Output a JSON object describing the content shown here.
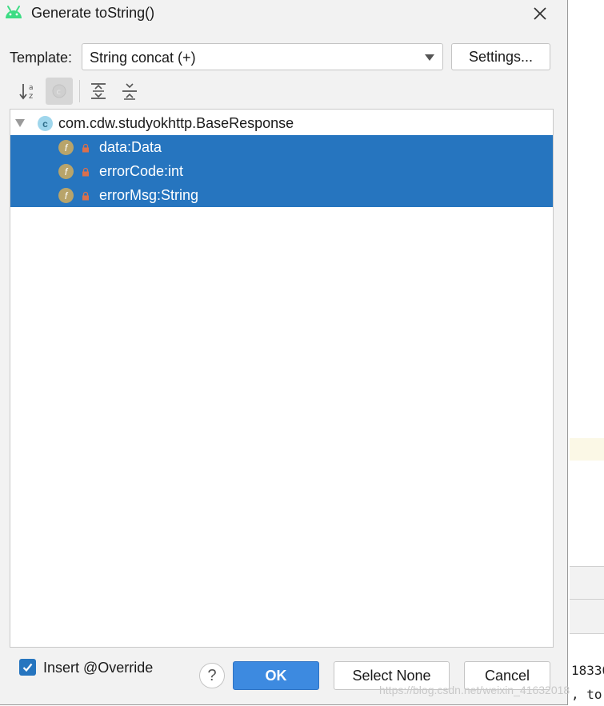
{
  "dialog": {
    "title": "Generate toString()",
    "template_label": "Template:",
    "template_value": "String concat (+)",
    "settings_label": "Settings...",
    "class_name": "com.cdw.studyokhttp.BaseResponse",
    "class_icon_letter": "c",
    "field_icon_letter": "f",
    "fields": [
      {
        "label": "data:Data",
        "selected": true
      },
      {
        "label": "errorCode:int",
        "selected": true
      },
      {
        "label": "errorMsg:String",
        "selected": true
      }
    ],
    "insert_override_label": "Insert @Override",
    "insert_override_checked": true,
    "help_label": "?",
    "ok_label": "OK",
    "select_none_label": "Select None",
    "cancel_label": "Cancel"
  },
  "toolbar_icons": [
    "sort-alphabetically-icon",
    "show-classes-icon",
    "expand-all-icon",
    "collapse-all-icon"
  ],
  "background": {
    "code_line_1": "18330",
    "code_line_2": ", to",
    "watermark": "https://blog.csdn.net/weixin_41632018"
  },
  "colors": {
    "selection": "#2675bf",
    "primary_button": "#3d8ae0",
    "android_green": "#3ddc84",
    "field_icon": "#b8a46a",
    "class_icon": "#9fd6ec"
  }
}
